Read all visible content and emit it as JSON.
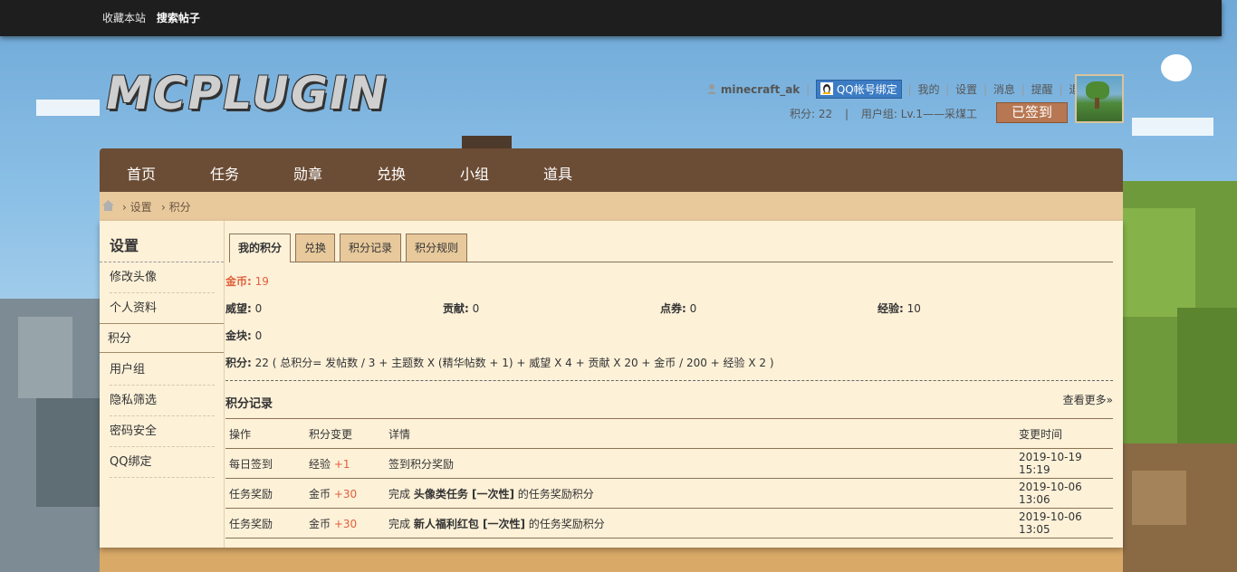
{
  "topbar": {
    "favorite": "收藏本站",
    "search": "搜索帖子"
  },
  "logo": {
    "text": "MCPLUGIN"
  },
  "user": {
    "name": "minecraft_ak",
    "qq_bind": "QQ帐号绑定",
    "menu": [
      "我的",
      "设置",
      "消息",
      "提醒",
      "退出"
    ],
    "credits": "积分: 22",
    "group": "用户组: Lv.1——采煤工",
    "sign_button": "已签到"
  },
  "nav": [
    "首页",
    "任务",
    "勋章",
    "兑换",
    "小组",
    "道具"
  ],
  "breadcrumb": [
    "设置",
    "积分"
  ],
  "sidebar": {
    "title": "设置",
    "items": [
      "修改头像",
      "个人资料",
      "积分",
      "用户组",
      "隐私筛选",
      "密码安全",
      "QQ绑定"
    ],
    "active_index": 2
  },
  "tabs": [
    "我的积分",
    "兑换",
    "积分记录",
    "积分规则"
  ],
  "stats": {
    "gold_label": "金币:",
    "gold_value": "19",
    "prestige_label": "威望:",
    "prestige_value": "0",
    "contribution_label": "贡献:",
    "contribution_value": "0",
    "coupon_label": "点券:",
    "coupon_value": "0",
    "exp_label": "经验:",
    "exp_value": "10",
    "nugget_label": "金块:",
    "nugget_value": "0",
    "total_label": "积分:",
    "total_value": "22 ( 总积分= 发帖数 / 3 + 主题数 X (精华帖数 + 1) + 威望 X 4 + 贡献 X 20 + 金币 / 200 + 经验 X 2 )"
  },
  "log": {
    "title": "积分记录",
    "more": "查看更多»",
    "headers": [
      "操作",
      "积分变更",
      "详情",
      "变更时间"
    ],
    "rows": [
      {
        "action": "每日签到",
        "type": "经验",
        "change": "+1",
        "detail_pre": "签到积分奖励",
        "detail_bold": "",
        "detail_post": "",
        "time": "2019-10-19 15:19"
      },
      {
        "action": "任务奖励",
        "type": "金币",
        "change": "+30",
        "detail_pre": "完成 ",
        "detail_bold": "头像类任务 [一次性]",
        "detail_post": " 的任务奖励积分",
        "time": "2019-10-06 13:06"
      },
      {
        "action": "任务奖励",
        "type": "金币",
        "change": "+30",
        "detail_pre": "完成 ",
        "detail_bold": "新人福利红包 [一次性]",
        "detail_post": " 的任务奖励积分",
        "time": "2019-10-06 13:05"
      }
    ]
  }
}
